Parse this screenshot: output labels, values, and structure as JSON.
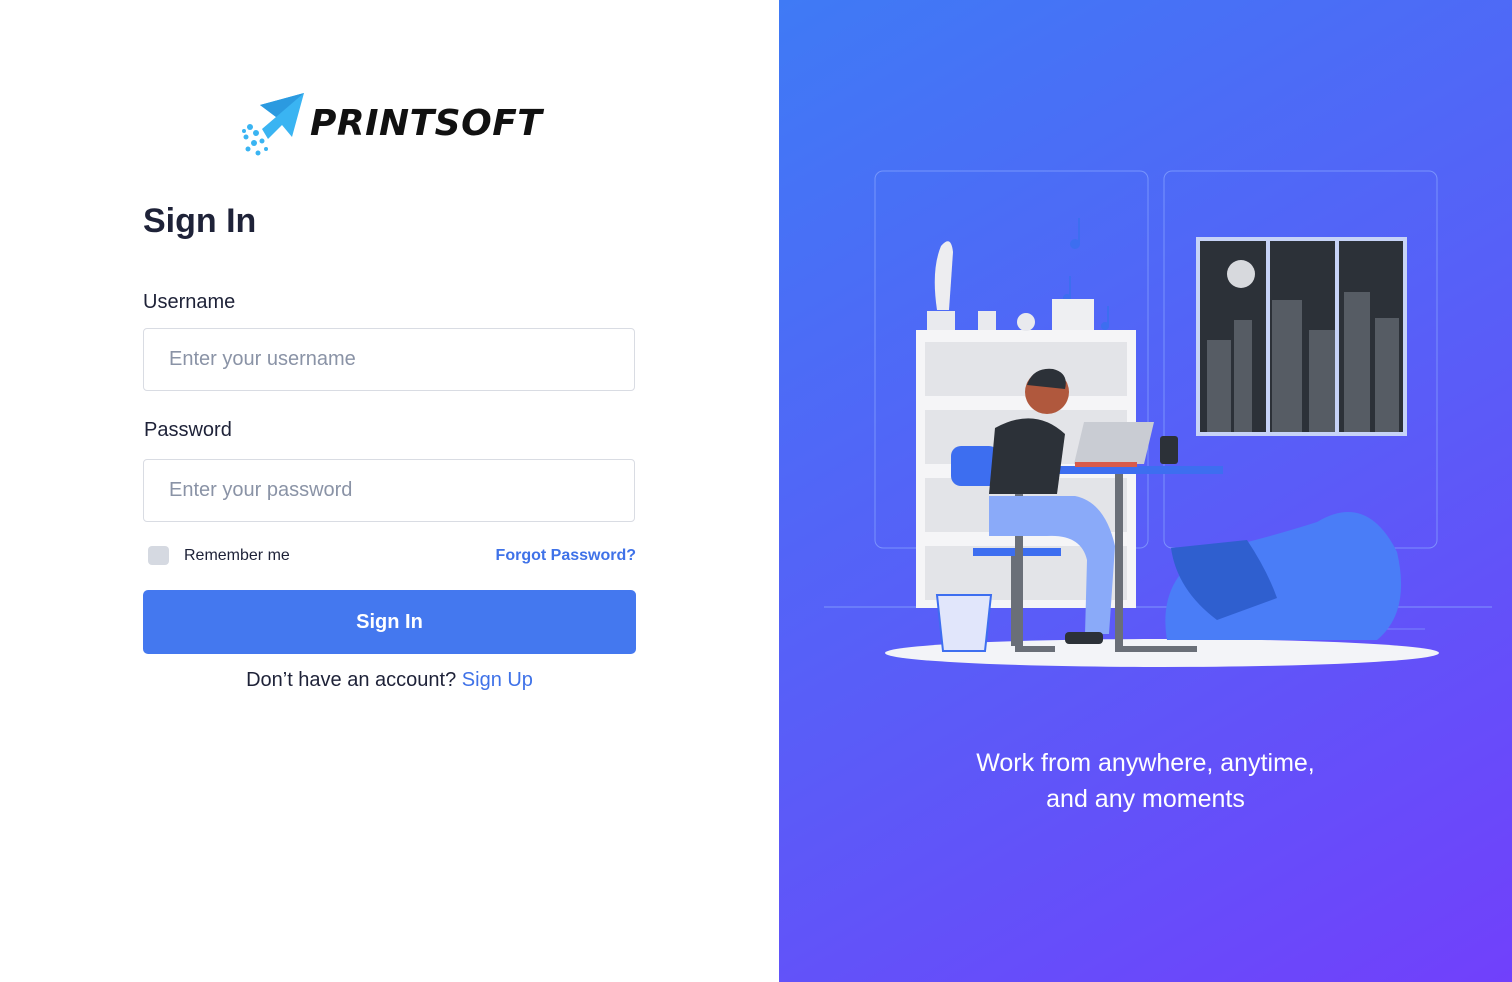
{
  "brand": {
    "name": "PRINTSOFT",
    "logo_icon": "rocket-arrow-icon",
    "logo_color": "#3ab4f2"
  },
  "form": {
    "title": "Sign In",
    "username": {
      "label": "Username",
      "placeholder": "Enter your username"
    },
    "password": {
      "label": "Password",
      "placeholder": "Enter your password"
    },
    "remember_label": "Remember me",
    "forgot_label": "Forgot Password?",
    "submit_label": "Sign In",
    "signup_prompt": "Don’t have an account?",
    "signup_link": "Sign Up"
  },
  "hero": {
    "tagline_line1": "Work from anywhere, anytime,",
    "tagline_line2": "and any moments",
    "illustration": "person-working-at-desk-illustration"
  },
  "colors": {
    "primary": "#4478ef",
    "link": "#3f72e8",
    "gradient_start": "#3f7af5",
    "gradient_end": "#7140fb",
    "text": "#1e2238"
  }
}
